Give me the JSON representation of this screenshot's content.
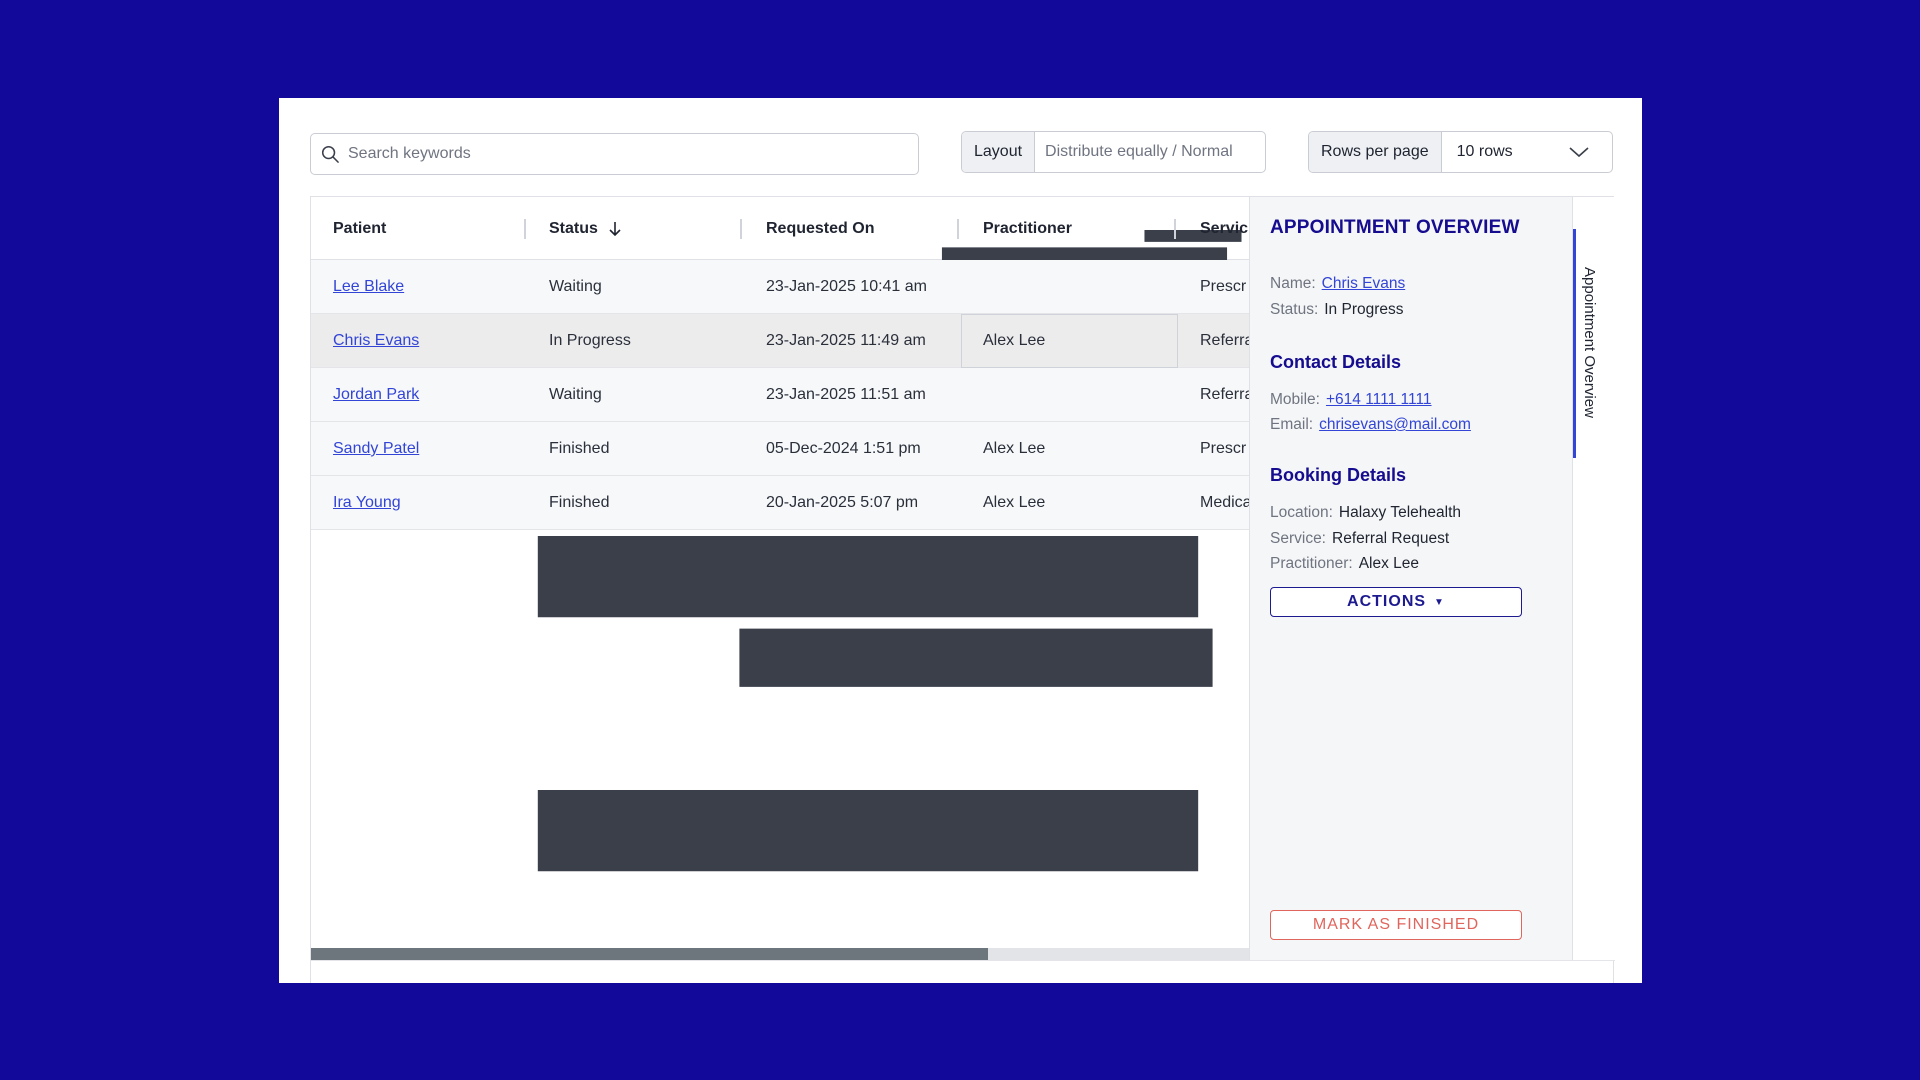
{
  "toolbar": {
    "search_placeholder": "Search keywords",
    "layout_label": "Layout",
    "layout_value": "Distribute equally / Normal",
    "rows_label": "Rows per page",
    "rows_value": "10 rows"
  },
  "table": {
    "columns": [
      "Patient",
      "Status",
      "Requested On",
      "Practitioner",
      "Servic"
    ],
    "rows": [
      {
        "patient": "Lee Blake",
        "status": "Waiting",
        "requested": "23-Jan-2025 10:41 am",
        "practitioner": "",
        "service": "Prescr"
      },
      {
        "patient": "Chris Evans",
        "status": "In Progress",
        "requested": "23-Jan-2025 11:49 am",
        "practitioner": "Alex Lee",
        "service": "Referra"
      },
      {
        "patient": "Jordan Park",
        "status": "Waiting",
        "requested": "23-Jan-2025 11:51 am",
        "practitioner": "",
        "service": "Referra"
      },
      {
        "patient": "Sandy Patel",
        "status": "Finished",
        "requested": "05-Dec-2024 1:51 pm",
        "practitioner": "Alex Lee",
        "service": "Prescr"
      },
      {
        "patient": "Ira Young",
        "status": "Finished",
        "requested": "20-Jan-2025 5:07 pm",
        "practitioner": "Alex Lee",
        "service": "Medica"
      }
    ]
  },
  "panel": {
    "title": "APPOINTMENT OVERVIEW",
    "name_label": "Name:",
    "name_value": "Chris Evans",
    "status_label": "Status:",
    "status_value": "In Progress",
    "contact_heading": "Contact Details",
    "mobile_label": "Mobile:",
    "mobile_value": "+614 1111 1111",
    "email_label": "Email:",
    "email_value": "chrisevans@mail.com",
    "booking_heading": "Booking Details",
    "location_label": "Location:",
    "location_value": "Halaxy Telehealth",
    "service_label": "Service:",
    "service_value": "Referral Request",
    "practitioner_label": "Practitioner:",
    "practitioner_value": "Alex Lee",
    "actions_label": "ACTIONS",
    "finish_label": "MARK AS FINISHED",
    "side_tab_label": "Appointment Overview"
  },
  "colors": {
    "background": "#12089a",
    "heading": "#150c8f",
    "link": "#3245d6",
    "danger": "#e0655c"
  }
}
